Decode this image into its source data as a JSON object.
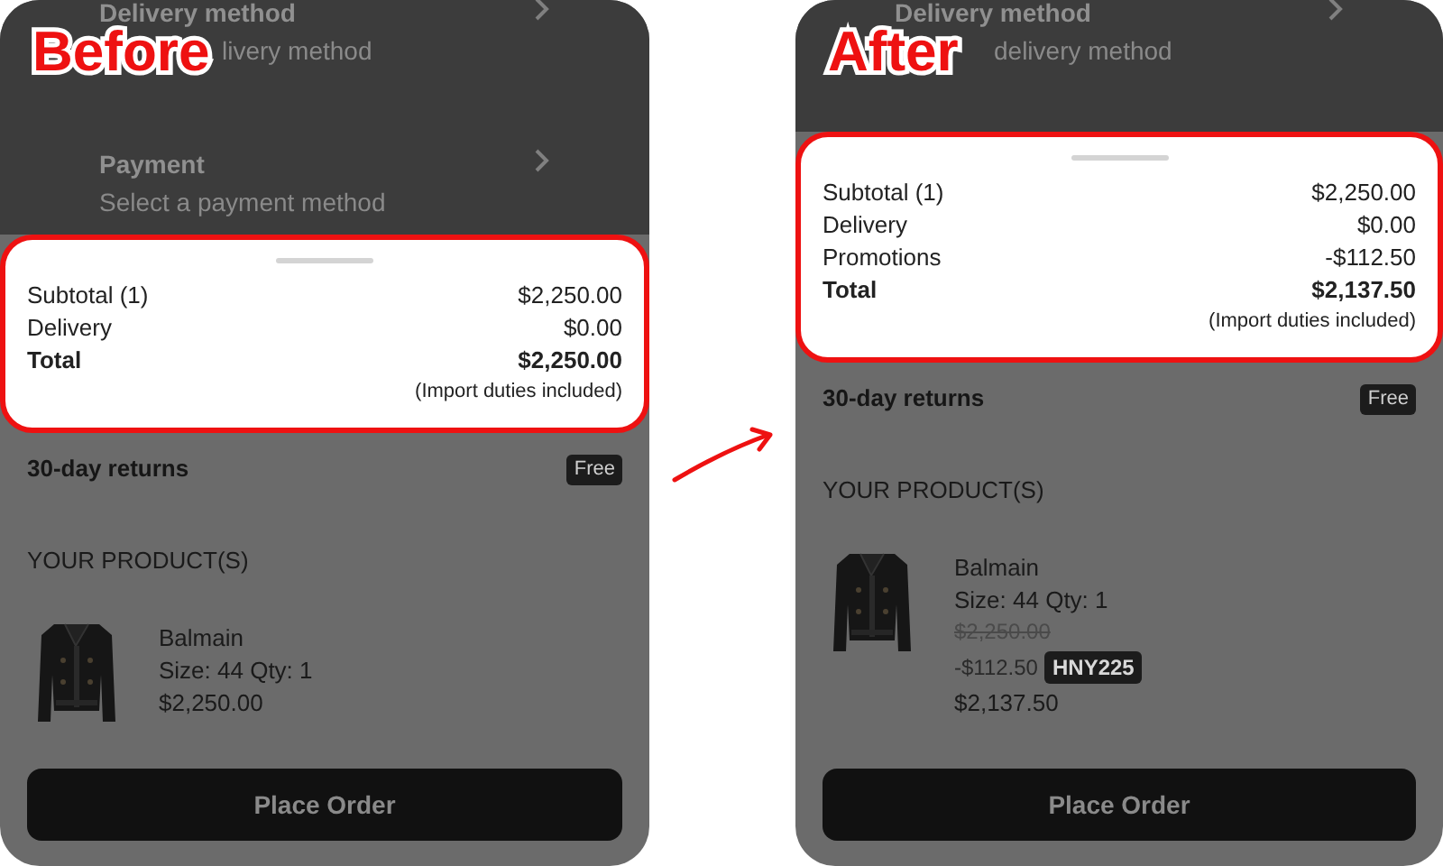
{
  "panels": [
    {
      "label": "Before",
      "sections": [
        {
          "title": "Delivery method",
          "subtitle": "livery method"
        },
        {
          "title": "Payment",
          "subtitle": "Select a payment method"
        }
      ],
      "summary": {
        "rows": [
          {
            "kind": "regular",
            "label": "Subtotal (1)",
            "value": "$2,250.00"
          },
          {
            "kind": "regular",
            "label": "Delivery",
            "value": "$0.00"
          },
          {
            "kind": "total",
            "label": "Total",
            "value": "$2,250.00"
          }
        ],
        "note": "(Import duties included)"
      },
      "returns": {
        "label": "30-day returns",
        "badge": "Free"
      },
      "products_heading": "YOUR PRODUCT(S)",
      "products": [
        {
          "brand": "Balmain",
          "details": "Size: 44 Qty: 1",
          "prices": [
            {
              "kind": "final",
              "text": "$2,250.00"
            }
          ]
        }
      ],
      "button": "Place Order"
    },
    {
      "label": "After",
      "sections": [
        {
          "title": "Delivery method",
          "subtitle": "delivery method"
        }
      ],
      "summary": {
        "rows": [
          {
            "kind": "regular",
            "label": "Subtotal (1)",
            "value": "$2,250.00"
          },
          {
            "kind": "regular",
            "label": "Delivery",
            "value": "$0.00"
          },
          {
            "kind": "regular",
            "label": "Promotions",
            "value": "-$112.50"
          },
          {
            "kind": "total",
            "label": "Total",
            "value": "$2,137.50"
          }
        ],
        "note": "(Import duties included)"
      },
      "returns": {
        "label": "30-day returns",
        "badge": "Free"
      },
      "products_heading": "YOUR PRODUCT(S)",
      "products": [
        {
          "brand": "Balmain",
          "details": "Size: 44 Qty: 1",
          "prices": [
            {
              "kind": "original",
              "text": "$2,250.00"
            },
            {
              "kind": "discount",
              "text": "-$112.50",
              "code": "HNY225"
            },
            {
              "kind": "final",
              "text": "$2,137.50"
            }
          ]
        }
      ],
      "button": "Place Order"
    }
  ]
}
